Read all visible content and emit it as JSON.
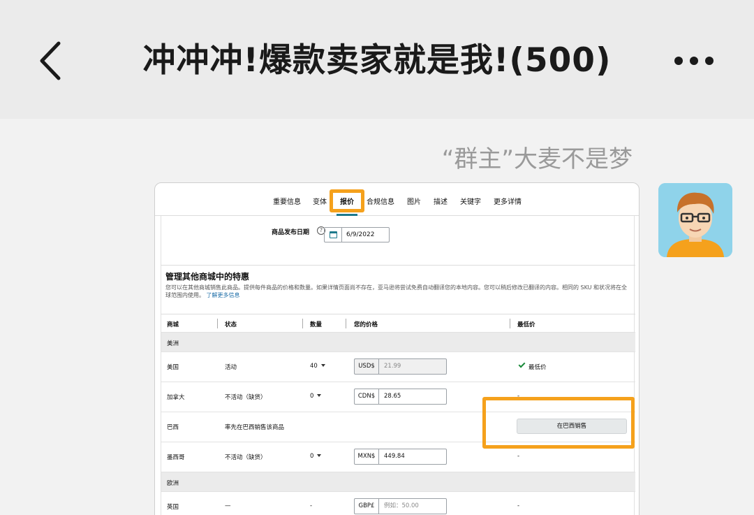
{
  "chat": {
    "title": "冲冲冲!爆款卖家就是我!(500)",
    "sender_name": "“群主”大麦不是梦"
  },
  "icons": {
    "back": "chevron-left-icon",
    "more": "more-dots-icon",
    "help": "help-circle-icon",
    "calendar": "calendar-icon",
    "check": "check-icon",
    "dropdown": "caret-down-icon"
  },
  "colors": {
    "highlight": "#f5a11c",
    "accent": "#1e7a8c",
    "link": "#1f6fa8",
    "check": "#1a8a3a"
  },
  "screenshot": {
    "tabs": [
      {
        "label": "重要信息"
      },
      {
        "label": "变体"
      },
      {
        "label": "报价",
        "active": true
      },
      {
        "label": "合规信息"
      },
      {
        "label": "图片"
      },
      {
        "label": "描述"
      },
      {
        "label": "关键字"
      },
      {
        "label": "更多详情"
      }
    ],
    "release_date": {
      "label": "商品发布日期",
      "help": "?",
      "value": "6/9/2022"
    },
    "section": {
      "title": "管理其他商城中的特惠",
      "description": "您可以在其他商城销售此商品。提供每件商品的价格和数量。如果详情页面尚不存在，亚马逊将尝试免费自动翻译您的本地内容。您可以稍后修改已翻译的内容。相同的 SKU 和状况将在全球范围内使用。",
      "link": "了解更多信息"
    },
    "table": {
      "headers": {
        "marketplace": "商城",
        "status": "状态",
        "quantity": "数量",
        "your_price": "您的价格",
        "lowest_price": "最低价"
      },
      "regions": [
        {
          "name": "美洲",
          "rows": [
            {
              "marketplace": "美国",
              "status": "活动",
              "quantity": "40",
              "currency": "USD$",
              "price": "21.99",
              "lowest": "最低价"
            },
            {
              "marketplace": "加拿大",
              "status": "不活动（缺货）",
              "quantity": "0",
              "currency": "CDN$",
              "price": "28.65",
              "lowest": "-"
            },
            {
              "marketplace": "巴西",
              "status": "率先在巴西销售该商品",
              "button": "在巴西销售"
            },
            {
              "marketplace": "墨西哥",
              "status": "不活动（缺货）",
              "quantity": "0",
              "currency": "MXN$",
              "price": "449.84",
              "lowest": "-"
            }
          ]
        },
        {
          "name": "欧洲",
          "rows": [
            {
              "marketplace": "英国",
              "status": "—",
              "quantity": "-",
              "currency": "GBP£",
              "placeholder": "例如：50.00",
              "lowest": "-"
            }
          ]
        }
      ]
    }
  }
}
